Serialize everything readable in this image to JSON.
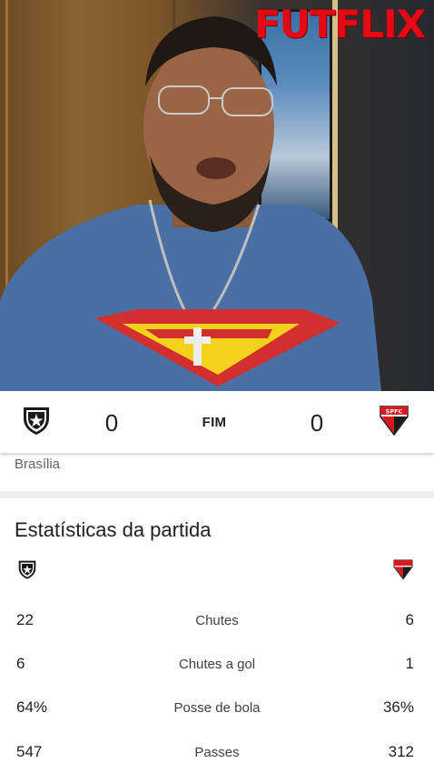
{
  "video": {
    "channel_logo": "FUTFLIX"
  },
  "match": {
    "home_team": {
      "crest_icon": "botafogo-crest-icon",
      "score": "0"
    },
    "away_team": {
      "crest_icon": "sao-paulo-crest-icon",
      "crest_text": "SPFC",
      "score": "0"
    },
    "status": "FIM",
    "venue": "Brasília"
  },
  "stats": {
    "title": "Estatísticas da partida",
    "rows": [
      {
        "home": "22",
        "label": "Chutes",
        "away": "6"
      },
      {
        "home": "6",
        "label": "Chutes a gol",
        "away": "1"
      },
      {
        "home": "64%",
        "label": "Posse de bola",
        "away": "36%"
      },
      {
        "home": "547",
        "label": "Passes",
        "away": "312"
      }
    ]
  },
  "colors": {
    "logo_red": "#e50914",
    "spfc_red": "#d71920",
    "shirt_blue": "#4a6fa5",
    "superman_red": "#d32f2f",
    "superman_yellow": "#f2d21a"
  }
}
